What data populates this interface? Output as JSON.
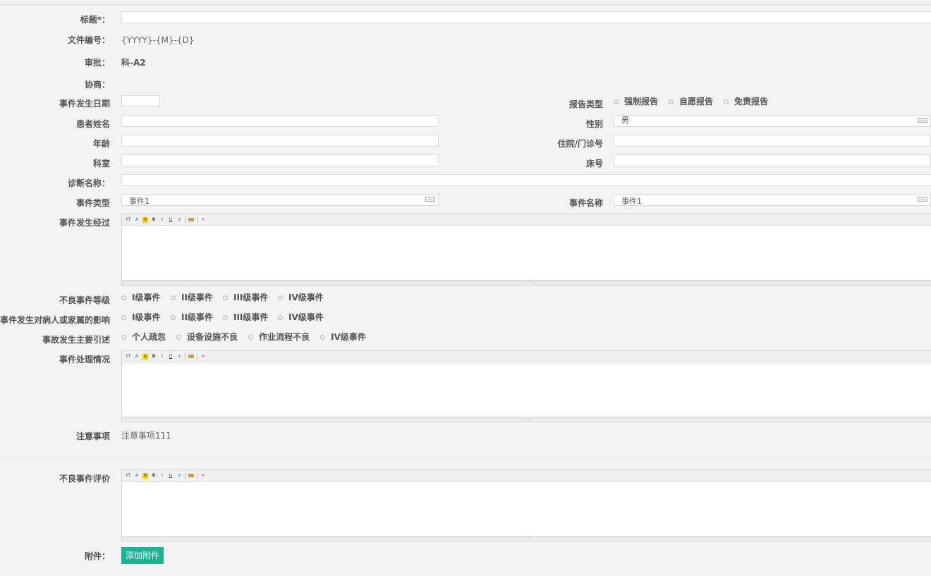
{
  "form": {
    "title": {
      "label": "标题*：",
      "value": ""
    },
    "doc_no": {
      "label": "文件编号：",
      "value": "{YYYY}-{M}-{D}"
    },
    "approval": {
      "label": "审批：",
      "value": "科-A2"
    },
    "consult": {
      "label": "协商："
    },
    "event_date": {
      "label": "事件发生日期",
      "value": ""
    },
    "report_type": {
      "label": "报告类型",
      "options": [
        "强制报告",
        "自愿报告",
        "免责报告"
      ]
    },
    "patient_name": {
      "label": "患者姓名",
      "value": ""
    },
    "gender": {
      "label": "性别",
      "value": "男",
      "picker": "..."
    },
    "age": {
      "label": "年龄",
      "value": ""
    },
    "record_no": {
      "label": "住院/门诊号",
      "value": ""
    },
    "department": {
      "label": "科室",
      "value": ""
    },
    "bed_no": {
      "label": "床号",
      "value": ""
    },
    "diagnosis": {
      "label": "诊断名称：",
      "value": ""
    },
    "event_type": {
      "label": "事件类型",
      "value": "事件1",
      "picker": "..."
    },
    "event_name": {
      "label": "事件名称",
      "value": "事件1",
      "picker": "..."
    },
    "event_process": {
      "label": "事件发生经过"
    },
    "adverse_level": {
      "label": "不良事件等级",
      "options": [
        "I级事件",
        "II级事件",
        "III级事件",
        "IV级事件"
      ]
    },
    "impact": {
      "label": "事件发生对病人或家属的影响",
      "options": [
        "I级事件",
        "II级事件",
        "III级事件",
        "IV级事件"
      ]
    },
    "cause": {
      "label": "事故发生主要引述",
      "options": [
        "个人疏忽",
        "设备设施不良",
        "作业流程不良",
        "IV级事件"
      ]
    },
    "handling": {
      "label": "事件处理情况"
    },
    "notes": {
      "label": "注意事项",
      "value": "注意事项111"
    },
    "evaluation": {
      "label": "不良事件评价"
    },
    "attachment": {
      "label": "附件：",
      "button": "添加附件"
    }
  },
  "editor_toolbar": [
    "tT",
    "A",
    "A",
    "B",
    "I",
    "U",
    "link",
    "img",
    "clear"
  ],
  "colors": {
    "accent": "#1ab394",
    "background": "#f3f3f3"
  }
}
